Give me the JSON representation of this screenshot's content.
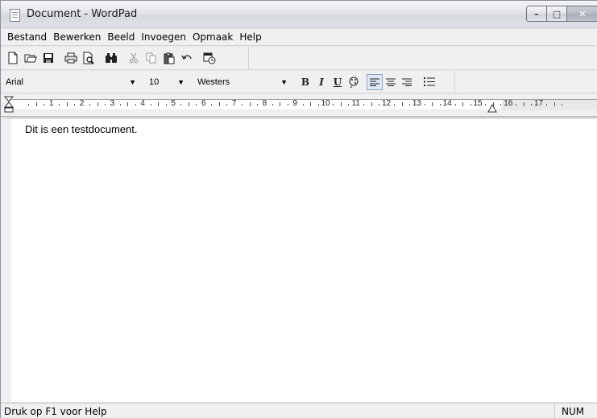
{
  "window": {
    "title": "Document - WordPad",
    "buttons": {
      "minimize": "–",
      "maximize": "□",
      "close": "✕"
    }
  },
  "menu": [
    "Bestand",
    "Bewerken",
    "Beeld",
    "Invoegen",
    "Opmaak",
    "Help"
  ],
  "toolbar": {
    "icons": [
      {
        "name": "new-document-icon",
        "glyph": "🗋"
      },
      {
        "name": "open-folder-icon",
        "glyph": "📂"
      },
      {
        "name": "save-disk-icon",
        "glyph": "💾"
      },
      {
        "name": "print-icon",
        "glyph": "🖶"
      },
      {
        "name": "print-preview-icon",
        "glyph": "🔍"
      },
      {
        "name": "find-binoculars-icon",
        "glyph": "🔭"
      },
      {
        "name": "cut-scissors-icon",
        "glyph": "✂"
      },
      {
        "name": "copy-icon",
        "glyph": "⎘"
      },
      {
        "name": "paste-clipboard-icon",
        "glyph": "📋"
      },
      {
        "name": "undo-icon",
        "glyph": "↶"
      },
      {
        "name": "insert-datetime-icon",
        "glyph": "🗓"
      }
    ]
  },
  "format": {
    "font": "Arial",
    "size": "10",
    "script": "Westers",
    "bold": "B",
    "italic": "I",
    "underline": "U",
    "color_icon": "palette-icon",
    "align": [
      "align-left-icon",
      "align-center-icon",
      "align-right-icon"
    ],
    "bullets_icon": "bullet-list-icon"
  },
  "ruler": {
    "numbers": [
      "1",
      "2",
      "3",
      "4",
      "5",
      "6",
      "7",
      "8",
      "9",
      "10",
      "11",
      "12",
      "13",
      "14",
      "15",
      "16",
      "17"
    ]
  },
  "document": {
    "text": "Dit is een testdocument."
  },
  "status": {
    "help": "Druk op F1 voor Help",
    "num": "NUM"
  }
}
